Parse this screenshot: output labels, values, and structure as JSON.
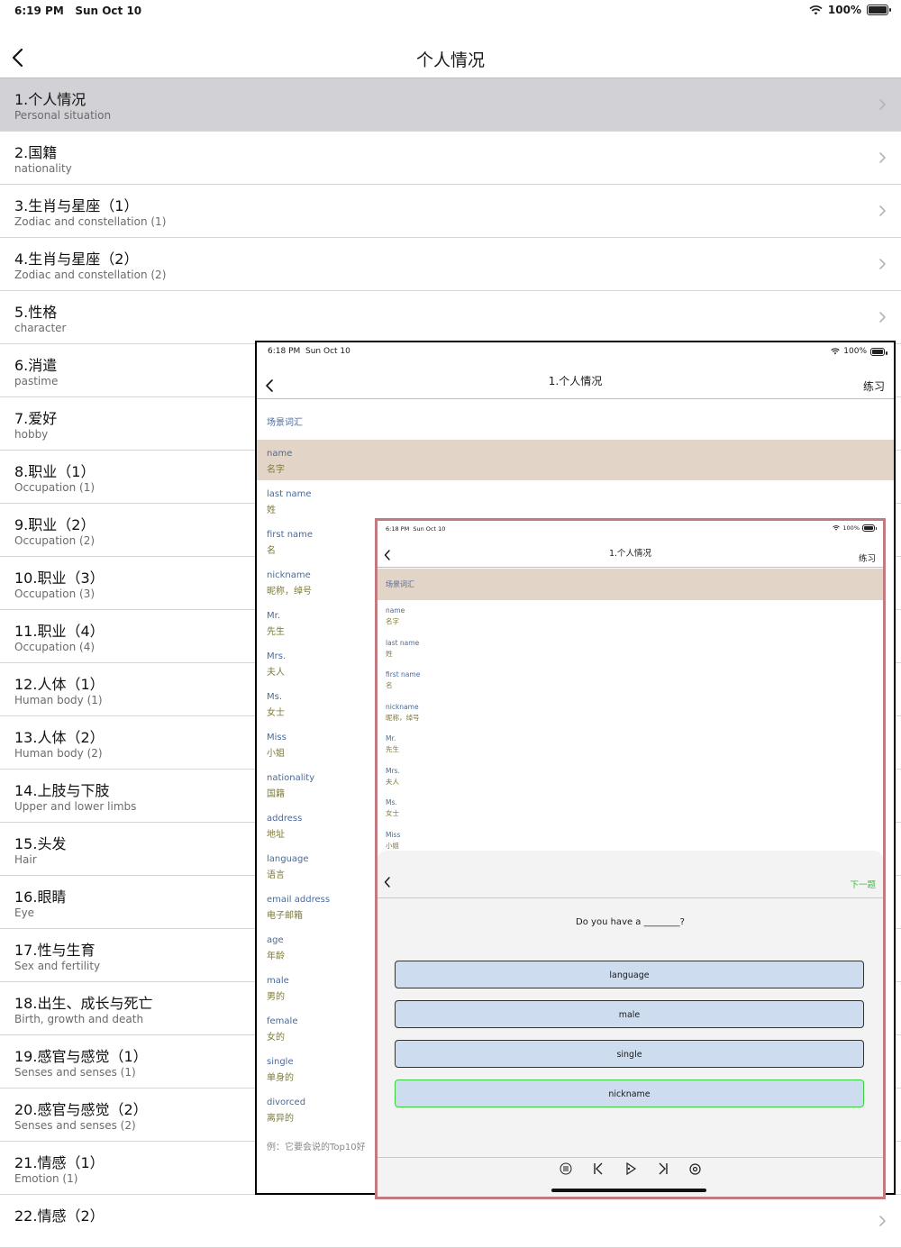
{
  "status": {
    "time": "6:19 PM",
    "date": "Sun Oct 10",
    "battery": "100%"
  },
  "nav": {
    "title": "个人情况"
  },
  "list": [
    {
      "title": "1.个人情况",
      "subtitle": "Personal situation"
    },
    {
      "title": "2.国籍",
      "subtitle": "nationality"
    },
    {
      "title": "3.生肖与星座（1）",
      "subtitle": "Zodiac and constellation (1)"
    },
    {
      "title": "4.生肖与星座（2）",
      "subtitle": "Zodiac and constellation (2)"
    },
    {
      "title": "5.性格",
      "subtitle": "character"
    },
    {
      "title": "6.消遣",
      "subtitle": "pastime"
    },
    {
      "title": "7.爱好",
      "subtitle": "hobby"
    },
    {
      "title": "8.职业（1）",
      "subtitle": "Occupation (1)"
    },
    {
      "title": "9.职业（2）",
      "subtitle": "Occupation (2)"
    },
    {
      "title": "10.职业（3）",
      "subtitle": "Occupation (3)"
    },
    {
      "title": "11.职业（4）",
      "subtitle": "Occupation (4)"
    },
    {
      "title": "12.人体（1）",
      "subtitle": "Human body (1)"
    },
    {
      "title": "13.人体（2）",
      "subtitle": "Human body (2)"
    },
    {
      "title": "14.上肢与下肢",
      "subtitle": "Upper and lower limbs"
    },
    {
      "title": "15.头发",
      "subtitle": "Hair"
    },
    {
      "title": "16.眼睛",
      "subtitle": "Eye"
    },
    {
      "title": "17.性与生育",
      "subtitle": "Sex and fertility"
    },
    {
      "title": "18.出生、成长与死亡",
      "subtitle": "Birth, growth and death"
    },
    {
      "title": "19.感官与感觉（1）",
      "subtitle": "Senses and senses (1)"
    },
    {
      "title": "20.感官与感觉（2）",
      "subtitle": "Senses and senses (2)"
    },
    {
      "title": "21.情感（1）",
      "subtitle": "Emotion (1)"
    },
    {
      "title": "22.情感（2）",
      "subtitle": ""
    }
  ],
  "overlay1": {
    "status": {
      "time": "6:18 PM",
      "date": "Sun Oct 10",
      "battery": "100%"
    },
    "title": "1.个人情况",
    "practice": "练习",
    "scene_label": "场景词汇",
    "words": [
      {
        "en": "name",
        "zh": "名字"
      },
      {
        "en": "last name",
        "zh": "姓"
      },
      {
        "en": "first name",
        "zh": "名"
      },
      {
        "en": "nickname",
        "zh": "昵称，绰号"
      },
      {
        "en": "Mr.",
        "zh": "先生"
      },
      {
        "en": "Mrs.",
        "zh": "夫人"
      },
      {
        "en": "Ms.",
        "zh": "女士"
      },
      {
        "en": "Miss",
        "zh": "小姐"
      },
      {
        "en": "nationality",
        "zh": "国籍"
      },
      {
        "en": "address",
        "zh": "地址"
      },
      {
        "en": "language",
        "zh": "语言"
      },
      {
        "en": "email address",
        "zh": "电子邮箱"
      },
      {
        "en": "age",
        "zh": "年龄"
      },
      {
        "en": "male",
        "zh": "男的"
      },
      {
        "en": "female",
        "zh": "女的"
      },
      {
        "en": "single",
        "zh": "单身的"
      },
      {
        "en": "divorced",
        "zh": "离异的"
      }
    ],
    "cut_text": "例：它要会说的Top10好"
  },
  "overlay2": {
    "status": {
      "time": "6:18 PM",
      "date": "Sun Oct 10",
      "battery": "100%"
    },
    "title": "1.个人情况",
    "practice": "练习",
    "scene_label": "场景词汇",
    "words": [
      {
        "en": "name",
        "zh": "名字"
      },
      {
        "en": "last name",
        "zh": "姓"
      },
      {
        "en": "first name",
        "zh": "名"
      },
      {
        "en": "nickname",
        "zh": "昵称，绰号"
      },
      {
        "en": "Mr.",
        "zh": "先生"
      },
      {
        "en": "Mrs.",
        "zh": "夫人"
      },
      {
        "en": "Ms.",
        "zh": "女士"
      },
      {
        "en": "Miss",
        "zh": "小姐"
      }
    ],
    "quiz": {
      "next": "下一题",
      "question": "Do you have a ________?",
      "options": [
        "language",
        "male",
        "single",
        "nickname"
      ],
      "highlighted_option": "nickname"
    },
    "toolbar_icons": [
      "list-icon",
      "previous-icon",
      "play-icon",
      "next-icon",
      "settings-icon"
    ]
  }
}
